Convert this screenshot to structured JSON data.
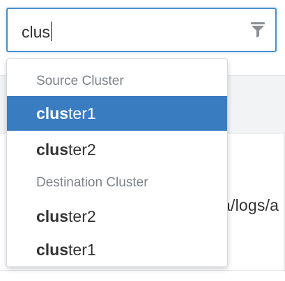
{
  "search": {
    "value": "clus"
  },
  "dropdown": {
    "groups": [
      {
        "header": "Source Cluster",
        "options": [
          {
            "match": "clus",
            "rest": "ter1",
            "selected": true
          },
          {
            "match": "clus",
            "rest": "ter2",
            "selected": false
          }
        ]
      },
      {
        "header": "Destination Cluster",
        "options": [
          {
            "match": "clus",
            "rest": "ter2",
            "selected": false
          },
          {
            "match": "clus",
            "rest": "ter1",
            "selected": false
          }
        ]
      }
    ]
  },
  "background": {
    "partial_path_text": "a/logs/a"
  },
  "colors": {
    "focus_border": "#4a8fd1",
    "selected_background": "#3a7cc0",
    "group_header_text": "#7d8287"
  },
  "icons": {
    "search_filter": "filter-icon"
  }
}
